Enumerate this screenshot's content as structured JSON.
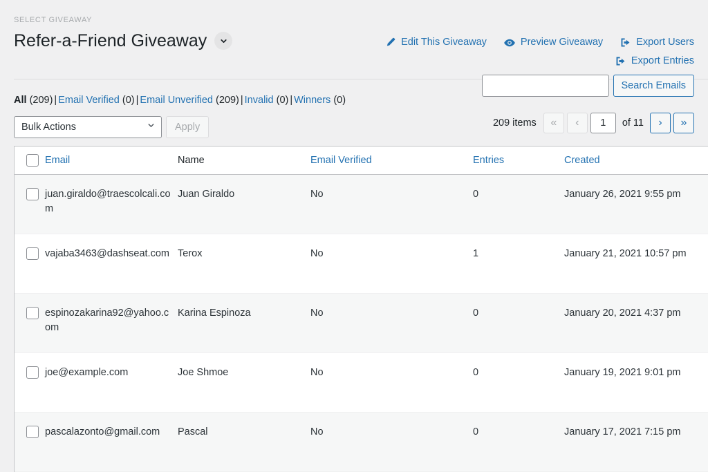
{
  "header": {
    "select_label": "SELECT GIVEAWAY",
    "title": "Refer-a-Friend Giveaway",
    "chevron_icon": "chevron-down-icon",
    "actions": [
      {
        "label": "Edit This Giveaway",
        "icon": "pencil-icon"
      },
      {
        "label": "Preview Giveaway",
        "icon": "eye-icon"
      },
      {
        "label": "Export Users",
        "icon": "export-icon"
      },
      {
        "label": "Export Entries",
        "icon": "export-icon"
      }
    ]
  },
  "filters": [
    {
      "label": "All",
      "count": "(209)",
      "current": true
    },
    {
      "label": "Email Verified",
      "count": "(0)",
      "current": false
    },
    {
      "label": "Email Unverified",
      "count": "(209)",
      "current": false
    },
    {
      "label": "Invalid",
      "count": "(0)",
      "current": false
    },
    {
      "label": "Winners",
      "count": "(0)",
      "current": false
    }
  ],
  "filter_separator": "|",
  "toolbar": {
    "bulk_actions_value": "Bulk Actions",
    "bulk_actions_options": [
      "Bulk Actions"
    ],
    "apply_label": "Apply",
    "apply_disabled": true
  },
  "search": {
    "value": "",
    "placeholder": "",
    "button_label": "Search Emails"
  },
  "pagination": {
    "items_label": "209 items",
    "first_label": "«",
    "prev_label": "‹",
    "current_page": "1",
    "of_label": "of 11",
    "next_label": "›",
    "last_label": "»",
    "first_enabled": false,
    "prev_enabled": false,
    "next_enabled": true,
    "last_enabled": true
  },
  "table": {
    "columns": [
      {
        "label": "Email",
        "sortable": true
      },
      {
        "label": "Name",
        "sortable": false
      },
      {
        "label": "Email Verified",
        "sortable": true
      },
      {
        "label": "Entries",
        "sortable": true
      },
      {
        "label": "Created",
        "sortable": true
      }
    ],
    "rows": [
      {
        "email": "juan.giraldo@traescolcali.com",
        "name": "Juan Giraldo",
        "email_verified": "No",
        "entries": "0",
        "created": "January 26, 2021 9:55 pm"
      },
      {
        "email": "vajaba3463@dashseat.com",
        "name": "Terox",
        "email_verified": "No",
        "entries": "1",
        "created": "January 21, 2021 10:57 pm"
      },
      {
        "email": "espinozakarina92@yahoo.com",
        "name": "Karina Espinoza",
        "email_verified": "No",
        "entries": "0",
        "created": "January 20, 2021 4:37 pm"
      },
      {
        "email": "joe@example.com",
        "name": "Joe Shmoe",
        "email_verified": "No",
        "entries": "0",
        "created": "January 19, 2021 9:01 pm"
      },
      {
        "email": "pascalazonto@gmail.com",
        "name": "Pascal",
        "email_verified": "No",
        "entries": "0",
        "created": "January 17, 2021 7:15 pm"
      }
    ]
  },
  "colors": {
    "link": "#2271b1",
    "page_bg": "#f0f0f1",
    "text": "#1d2327",
    "muted": "#a7aaad",
    "row_alt": "#f6f7f7"
  }
}
